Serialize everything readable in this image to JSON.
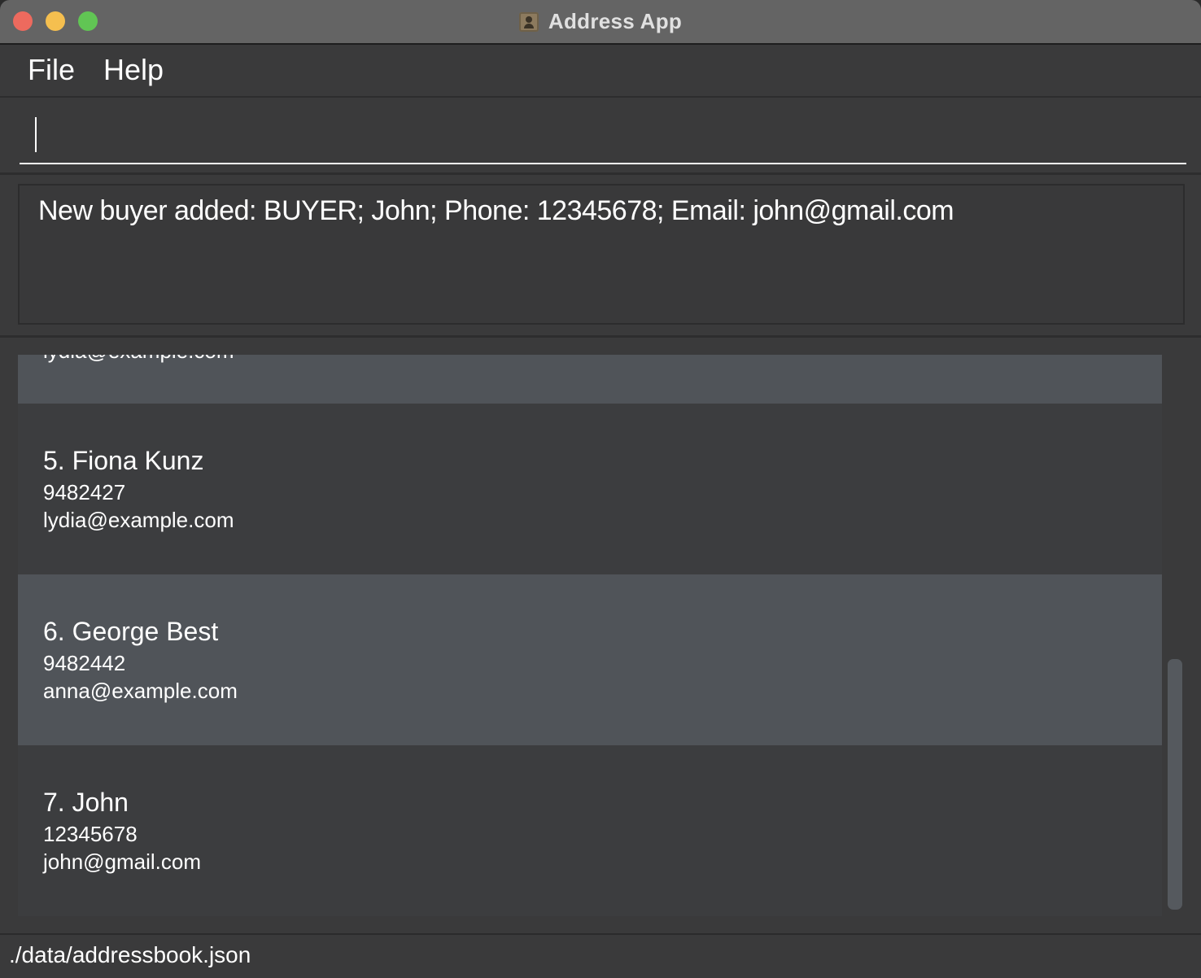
{
  "window": {
    "title": "Address App"
  },
  "menu": {
    "items": [
      "File",
      "Help"
    ]
  },
  "command_box": {
    "value": ""
  },
  "result_display": {
    "text": "New buyer added: BUYER; John; Phone: 12345678; Email: john@gmail.com"
  },
  "person_list": {
    "partial_top_email": "lydia@example.com",
    "cards": [
      {
        "index_name": "5. Fiona Kunz",
        "phone": "9482427",
        "email": "lydia@example.com"
      },
      {
        "index_name": "6. George Best",
        "phone": "9482442",
        "email": "anna@example.com"
      },
      {
        "index_name": "7. John",
        "phone": "12345678",
        "email": "john@gmail.com"
      }
    ]
  },
  "status_bar": {
    "file_path": "./data/addressbook.json"
  },
  "colors": {
    "titlebar": "#646464",
    "background": "#3a3a3b",
    "card_dark": "#3c3d3f",
    "card_light": "#505459",
    "close": "#ed6a5e",
    "minimize": "#f5bf4f",
    "maximize": "#61c554"
  }
}
